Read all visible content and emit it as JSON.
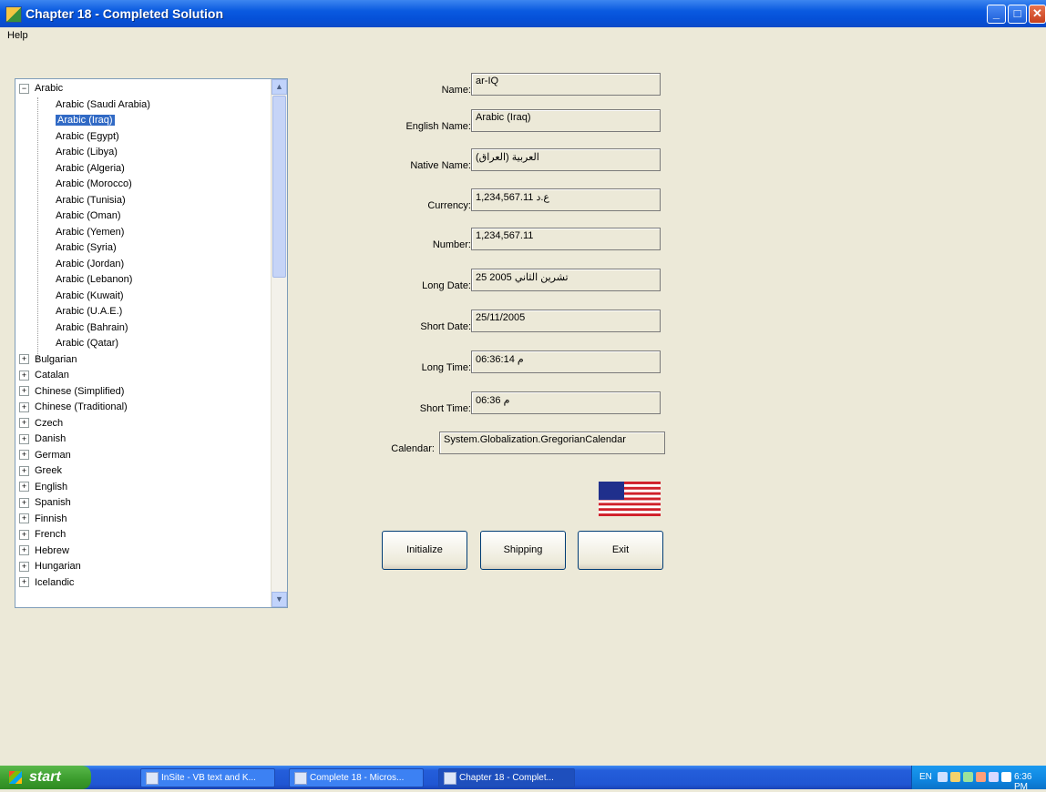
{
  "window": {
    "title": "Chapter 18 - Completed Solution"
  },
  "menu": {
    "items": [
      "Help"
    ]
  },
  "tree": {
    "root_expanded": "Arabic",
    "children": [
      "Arabic (Saudi Arabia)",
      "Arabic (Iraq)",
      "Arabic (Egypt)",
      "Arabic (Libya)",
      "Arabic (Algeria)",
      "Arabic (Morocco)",
      "Arabic (Tunisia)",
      "Arabic (Oman)",
      "Arabic (Yemen)",
      "Arabic (Syria)",
      "Arabic (Jordan)",
      "Arabic (Lebanon)",
      "Arabic (Kuwait)",
      "Arabic (U.A.E.)",
      "Arabic (Bahrain)",
      "Arabic (Qatar)"
    ],
    "selected": "Arabic (Iraq)",
    "collapsed_roots": [
      "Bulgarian",
      "Catalan",
      "Chinese (Simplified)",
      "Chinese (Traditional)",
      "Czech",
      "Danish",
      "German",
      "Greek",
      "English",
      "Spanish",
      "Finnish",
      "French",
      "Hebrew",
      "Hungarian",
      "Icelandic"
    ],
    "expanded_glyph": "−",
    "collapsed_glyph": "+"
  },
  "fields": [
    {
      "label": "Name:",
      "value": "ar-IQ"
    },
    {
      "label": "English Name:",
      "value": "Arabic (Iraq)"
    },
    {
      "label": "Native Name:",
      "value": "(العربية (العراق"
    },
    {
      "label": "Currency:",
      "value": "1,234,567.11 ع.د"
    },
    {
      "label": "Number:",
      "value": "1,234,567.11"
    },
    {
      "label": "Long Date:",
      "value": "25 2005 تشرين الثاني"
    },
    {
      "label": "Short Date:",
      "value": "25/11/2005"
    },
    {
      "label": "Long Time:",
      "value": "06:36:14 م"
    },
    {
      "label": "Short Time:",
      "value": "06:36 م"
    },
    {
      "label": "Calendar:",
      "value": "System.Globalization.GregorianCalendar"
    }
  ],
  "buttons": {
    "initialize": "Initialize",
    "shipping": "Shipping",
    "exit": "Exit"
  },
  "flag": {
    "icon": "us-flag-icon",
    "colors": {
      "red": "#d0202a",
      "white": "#ffffff",
      "blue": "#1f2f8c"
    }
  },
  "taskbar": {
    "start_label": "start",
    "items": [
      "InSite - VB text and K...",
      "Complete 18 - Micros...",
      "Chapter 18 - Complet..."
    ],
    "tray_language": "EN",
    "clock": "6:36 PM"
  }
}
